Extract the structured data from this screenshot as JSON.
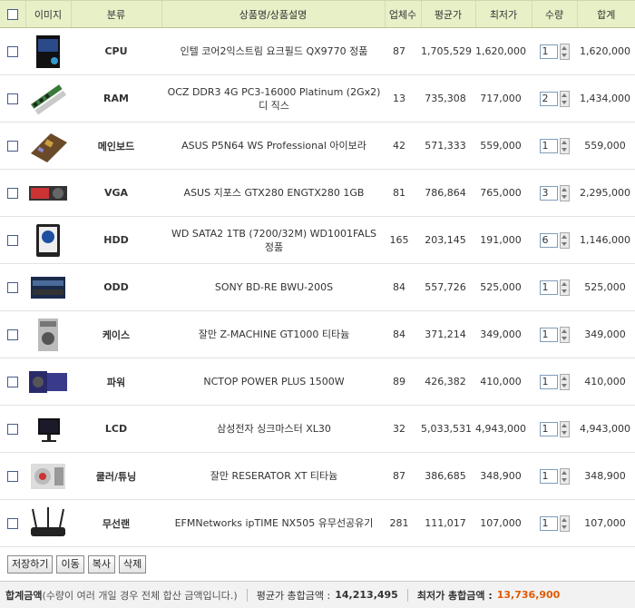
{
  "header": {
    "image": "이미지",
    "category": "분류",
    "product": "상품명/상품설명",
    "vendors": "업체수",
    "avg_price": "평균가",
    "low_price": "최저가",
    "qty": "수량",
    "total": "합계"
  },
  "rows": [
    {
      "category": "CPU",
      "name": "인텔 코어2익스트림 요크필드 QX9770 정품",
      "vendors": "87",
      "avg": "1,705,529",
      "low": "1,620,000",
      "qty": "1",
      "total": "1,620,000",
      "thumb": "cpu-box"
    },
    {
      "category": "RAM",
      "name": "OCZ DDR3 4G PC3-16000 Platinum (2Gx2) 디 직스",
      "vendors": "13",
      "avg": "735,308",
      "low": "717,000",
      "qty": "2",
      "total": "1,434,000",
      "thumb": "ram-sticks"
    },
    {
      "category": "메인보드",
      "name": "ASUS P5N64 WS Professional 아이보라",
      "vendors": "42",
      "avg": "571,333",
      "low": "559,000",
      "qty": "1",
      "total": "559,000",
      "thumb": "motherboard"
    },
    {
      "category": "VGA",
      "name": "ASUS 지포스 GTX280 ENGTX280 1GB",
      "vendors": "81",
      "avg": "786,864",
      "low": "765,000",
      "qty": "3",
      "total": "2,295,000",
      "thumb": "graphics-card"
    },
    {
      "category": "HDD",
      "name": "WD SATA2 1TB (7200/32M) WD1001FALS 정품",
      "vendors": "165",
      "avg": "203,145",
      "low": "191,000",
      "qty": "6",
      "total": "1,146,000",
      "thumb": "hard-drive"
    },
    {
      "category": "ODD",
      "name": "SONY BD-RE BWU-200S",
      "vendors": "84",
      "avg": "557,726",
      "low": "525,000",
      "qty": "1",
      "total": "525,000",
      "thumb": "optical-drive"
    },
    {
      "category": "케이스",
      "name": "잘만 Z-MACHINE GT1000 티타늄",
      "vendors": "84",
      "avg": "371,214",
      "low": "349,000",
      "qty": "1",
      "total": "349,000",
      "thumb": "pc-case"
    },
    {
      "category": "파워",
      "name": "NCTOP POWER PLUS 1500W",
      "vendors": "89",
      "avg": "426,382",
      "low": "410,000",
      "qty": "1",
      "total": "410,000",
      "thumb": "power-supply"
    },
    {
      "category": "LCD",
      "name": "삼성전자 싱크마스터 XL30",
      "vendors": "32",
      "avg": "5,033,531",
      "low": "4,943,000",
      "qty": "1",
      "total": "4,943,000",
      "thumb": "monitor"
    },
    {
      "category": "쿨러/튜닝",
      "name": "잘만 RESERATOR XT 티타늄",
      "vendors": "87",
      "avg": "386,685",
      "low": "348,900",
      "qty": "1",
      "total": "348,900",
      "thumb": "cooler"
    },
    {
      "category": "무선랜",
      "name": "EFMNetworks ipTIME NX505 유무선공유기",
      "vendors": "281",
      "avg": "111,017",
      "low": "107,000",
      "qty": "1",
      "total": "107,000",
      "thumb": "router"
    }
  ],
  "actions": {
    "save": "저장하기",
    "move": "이동",
    "copy": "복사",
    "delete": "삭제"
  },
  "summary": {
    "label": "합계금액",
    "note": "(수량이 여러 개일 경우 전체 합산 금액입니다.)",
    "avg_label": "평균가 총합금액 :",
    "avg_value": "14,213,495",
    "low_label": "최저가 총합금액 :",
    "low_value": "13,736,900"
  },
  "colors": {
    "header_bg": "#e8f0c8",
    "low_price": "#e07b1a",
    "low_total": "#e05a00"
  }
}
